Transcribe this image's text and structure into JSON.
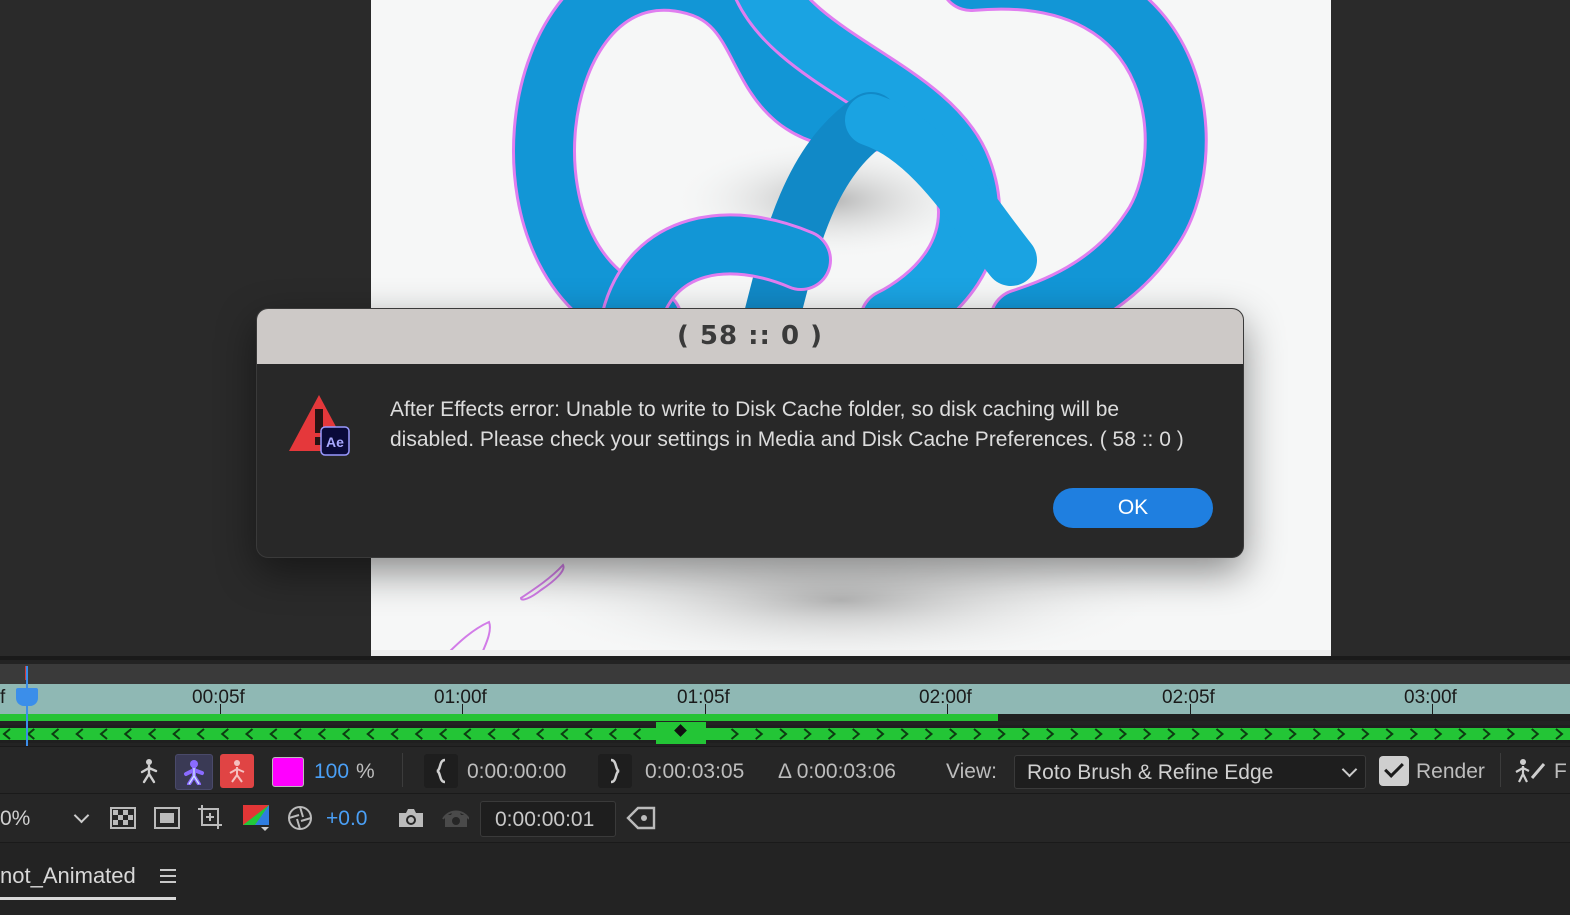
{
  "dialog": {
    "title": "( 58 :: 0 )",
    "message_line1": "After Effects error: Unable to write to Disk Cache folder, so disk caching will be",
    "message_line2": "disabled. Please check your settings in Media and Disk Cache Preferences. ( 58 :: 0 )",
    "ok_label": "OK",
    "icon": "ae-warning-icon",
    "icon_badge": "Ae"
  },
  "timeline": {
    "left_edge_label": "f",
    "ticks": [
      "00:05f",
      "01:00f",
      "01:05f",
      "02:00f",
      "02:05f",
      "03:00f"
    ],
    "colors": {
      "ruler": "#8fb8b4",
      "progress": "#27c336",
      "playhead": "#3b8eea"
    }
  },
  "toolbar": {
    "zoom_percent": "100",
    "percent_sign": "%",
    "in_point": "0:00:00:00",
    "out_point": "0:00:03:05",
    "duration": "Δ 0:00:03:06",
    "view_label": "View:",
    "view_value": "Roto Brush & Refine Edge",
    "render_label": "Render",
    "truncated_label": "F"
  },
  "toolbar2": {
    "magnification": "0%",
    "exposure": "+0.0",
    "current_time": "0:00:00:01"
  },
  "panel": {
    "comp_tab": "not_Animated"
  }
}
